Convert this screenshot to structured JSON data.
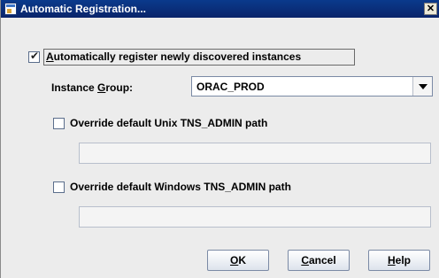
{
  "window": {
    "title": "Automatic Registration...",
    "close_glyph": "✕"
  },
  "auto_register": {
    "checked": true,
    "label_pre": "",
    "label_mnemonic": "A",
    "label_post": "utomatically register newly discovered instances"
  },
  "instance_group": {
    "label_pre": "Instance ",
    "label_mnemonic": "G",
    "label_post": "roup:",
    "value": "ORAC_PROD"
  },
  "unix_override": {
    "checked": false,
    "label": "Override default Unix TNS_ADMIN path",
    "path_value": ""
  },
  "windows_override": {
    "checked": false,
    "label": "Override default Windows TNS_ADMIN path",
    "path_value": ""
  },
  "buttons": {
    "ok": {
      "mnemonic": "O",
      "rest": "K"
    },
    "cancel": {
      "mnemonic": "C",
      "rest": "ancel"
    },
    "help": {
      "mnemonic": "H",
      "rest": "elp"
    }
  },
  "check_glyph": "✔"
}
